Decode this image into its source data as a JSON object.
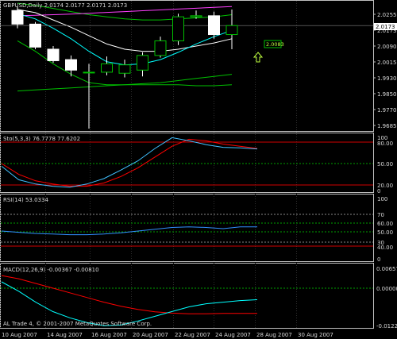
{
  "colors": {
    "background": "#000000",
    "frame": "#c0c0c0",
    "grid": "#2e2e2e",
    "candle": "#ffffff",
    "candle_fill_bear": "#ffffff",
    "candle_fill_bull": "#000000",
    "ma_fast": "#00ffff",
    "ma_slow": "#ffffff",
    "ma_env": "#00c000",
    "pink_line": "#ff40ff",
    "level_red": "#d00000",
    "level_green": "#00a000",
    "signal": "#ff0000",
    "stoch_main": "#40c0ff",
    "rsi": "#3090ff"
  },
  "main_panel": {
    "title": "GBPUSD,Daily  2.0174 2.0177 2.0171 2.0173",
    "price_ticks": [
      "2.0255",
      "2.0173",
      "2.0090",
      "2.0015",
      "1.9930",
      "1.9850",
      "1.9770",
      "1.9685"
    ],
    "last_price_box": "2.0173",
    "mid_box": "2.0083",
    "up_arrow_icon": "up-arrow-icon"
  },
  "stoch_panel": {
    "title": "Sto(5,3,3) 76.7778 77.6202",
    "ticks": [
      "100",
      "80.00",
      "50.00",
      "20.00",
      "0"
    ]
  },
  "rsi_panel": {
    "title": "RSI(14) 53.0334",
    "ticks": [
      "100",
      "70",
      "60.00",
      "50.00",
      "30",
      "40.00",
      "0"
    ]
  },
  "macd_panel": {
    "title": "MACD(12,26,9) -0.00367 -0.00810",
    "ticks": [
      "0.00657",
      "0.00000",
      "-0.01221"
    ],
    "watermark": "AL Trade 4, © 2001-2007 MetaQuotes Software Corp."
  },
  "date_labels": [
    "10 Aug 2007",
    "14 Aug 2007",
    "16 Aug 2007",
    "20 Aug 2007",
    "22 Aug 2007",
    "24 Aug 2007",
    "28 Aug 2007",
    "30 Aug 2007"
  ],
  "chart_data": {
    "type": "candlestick",
    "symbol": "GBPUSD",
    "timeframe": "Daily",
    "candles": [
      {
        "open": 2.0245,
        "high": 2.0265,
        "low": 2.016,
        "close": 2.018
      },
      {
        "open": 2.018,
        "high": 2.019,
        "low": 2.006,
        "close": 2.007
      },
      {
        "open": 2.006,
        "high": 2.0075,
        "low": 1.9995,
        "close": 2.0005
      },
      {
        "open": 2.001,
        "high": 2.003,
        "low": 1.993,
        "close": 1.996
      },
      {
        "open": 1.995,
        "high": 1.999,
        "low": 1.968,
        "close": 1.995
      },
      {
        "open": 1.995,
        "high": 2.0025,
        "low": 1.9935,
        "close": 1.999
      },
      {
        "open": 1.9945,
        "high": 2.001,
        "low": 1.9925,
        "close": 1.9985
      },
      {
        "open": 1.996,
        "high": 2.0045,
        "low": 1.993,
        "close": 2.003
      },
      {
        "open": 2.003,
        "high": 2.012,
        "low": 2.002,
        "close": 2.01
      },
      {
        "open": 2.01,
        "high": 2.023,
        "low": 2.008,
        "close": 2.0215
      },
      {
        "open": 2.0215,
        "high": 2.0245,
        "low": 2.0205,
        "close": 2.022
      },
      {
        "open": 2.022,
        "high": 2.024,
        "low": 2.011,
        "close": 2.013
      },
      {
        "open": 2.013,
        "high": 2.025,
        "low": 2.006,
        "close": 2.0173
      }
    ],
    "ma_fast": [
      2.023,
      2.0205,
      2.016,
      2.011,
      2.005,
      2.0,
      1.9985,
      1.999,
      2.001,
      2.0045,
      2.0085,
      2.012,
      2.015
    ],
    "ma_slow": [
      2.025,
      2.0235,
      2.02,
      2.0165,
      2.0125,
      2.0085,
      2.006,
      2.005,
      2.005,
      2.006,
      2.0075,
      2.009,
      2.011
    ],
    "env_upper": [
      2.028,
      2.027,
      2.0255,
      2.024,
      2.0225,
      2.0215,
      2.0205,
      2.02,
      2.02,
      2.0205,
      2.021,
      2.0215,
      2.0225
    ],
    "env_lower": [
      2.01,
      2.005,
      1.999,
      1.994,
      1.99,
      1.989,
      1.989,
      1.989,
      1.989,
      1.989,
      1.9885,
      1.9885,
      1.989
    ],
    "trend_line": [
      1.986,
      1.9865,
      1.987,
      1.9875,
      1.988,
      1.9885,
      1.989,
      1.9895,
      1.99,
      1.991,
      1.992,
      1.993,
      1.994
    ],
    "pink_line": [
      2.022,
      2.0222,
      2.0225,
      2.0228,
      2.0232,
      2.0236,
      2.024,
      2.0244,
      2.0248,
      2.0252,
      2.0256,
      2.026,
      2.0264
    ],
    "price_range": [
      1.968,
      2.0265
    ],
    "stoch_main": [
      45,
      20,
      12,
      8,
      6,
      12,
      22,
      38,
      55,
      78,
      98,
      92,
      85,
      80,
      79,
      77
    ],
    "stoch_signal": [
      50,
      30,
      18,
      12,
      8,
      8,
      14,
      26,
      42,
      62,
      82,
      95,
      92,
      86,
      82,
      78
    ],
    "rsi": [
      46,
      44,
      42,
      41,
      40,
      40,
      41,
      43,
      46,
      49,
      52,
      53,
      52,
      50,
      53,
      53
    ],
    "macd_main": [
      0.002,
      -0.001,
      -0.0045,
      -0.0075,
      -0.0095,
      -0.011,
      -0.012,
      -0.0118,
      -0.0105,
      -0.009,
      -0.0075,
      -0.006,
      -0.005,
      -0.0045,
      -0.004,
      -0.0037
    ],
    "macd_signal": [
      0.004,
      0.003,
      0.0015,
      0.0,
      -0.0015,
      -0.003,
      -0.0045,
      -0.0058,
      -0.0068,
      -0.0076,
      -0.008,
      -0.0082,
      -0.0082,
      -0.0081,
      -0.0081,
      -0.0081
    ],
    "macd_range": [
      -0.01221,
      0.00657
    ]
  }
}
